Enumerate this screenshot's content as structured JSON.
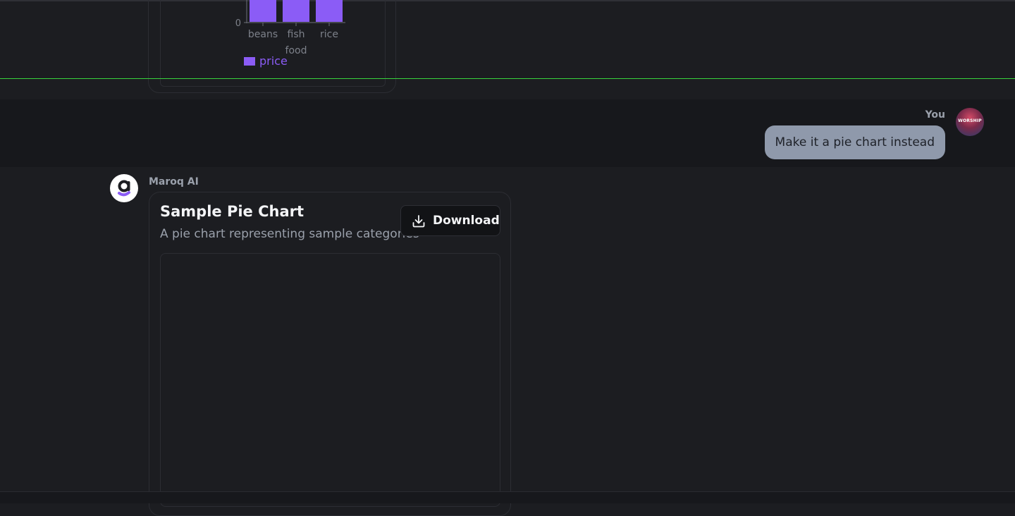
{
  "previous_chart": {
    "chart_data": {
      "type": "bar",
      "categories": [
        "beans",
        "fish",
        "rice"
      ],
      "series": [
        {
          "name": "price",
          "values": [
            1,
            1,
            1
          ]
        }
      ],
      "xlabel": "food",
      "ylabel": "",
      "y_ticks_visible": [
        "0"
      ],
      "legend_position": "bottom",
      "colors": {
        "bar": "#8b5cf6"
      }
    }
  },
  "user_message": {
    "sender": "You",
    "text": "Make it a pie chart instead",
    "avatar_text": "WORSHIP"
  },
  "ai_message": {
    "sender": "Maroq AI",
    "card": {
      "title": "Sample Pie Chart",
      "subtitle": "A pie chart representing sample categories",
      "download_label": "Download"
    }
  },
  "colors": {
    "background": "#1c1d21",
    "accent_purple": "#8b5cf6",
    "user_bubble": "#8f99ab",
    "divider_green": "#37d33d"
  }
}
